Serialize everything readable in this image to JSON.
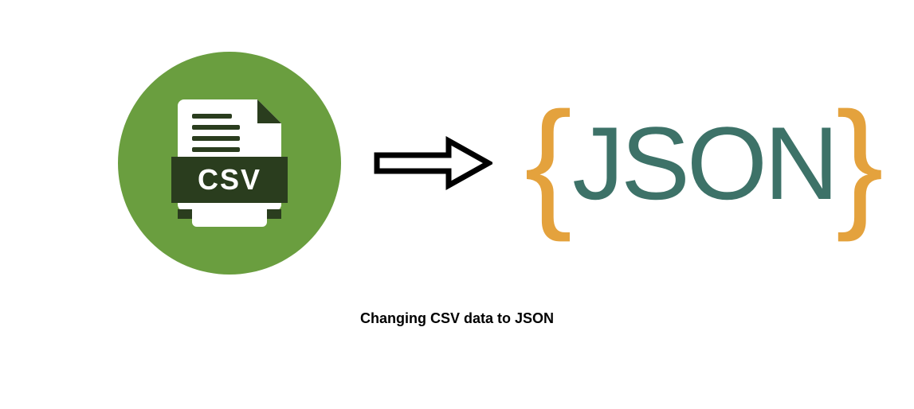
{
  "csv": {
    "label": "CSV"
  },
  "json": {
    "brace_open": "{",
    "text": "JSON",
    "brace_close": "}"
  },
  "caption": "Changing CSV data to JSON"
}
